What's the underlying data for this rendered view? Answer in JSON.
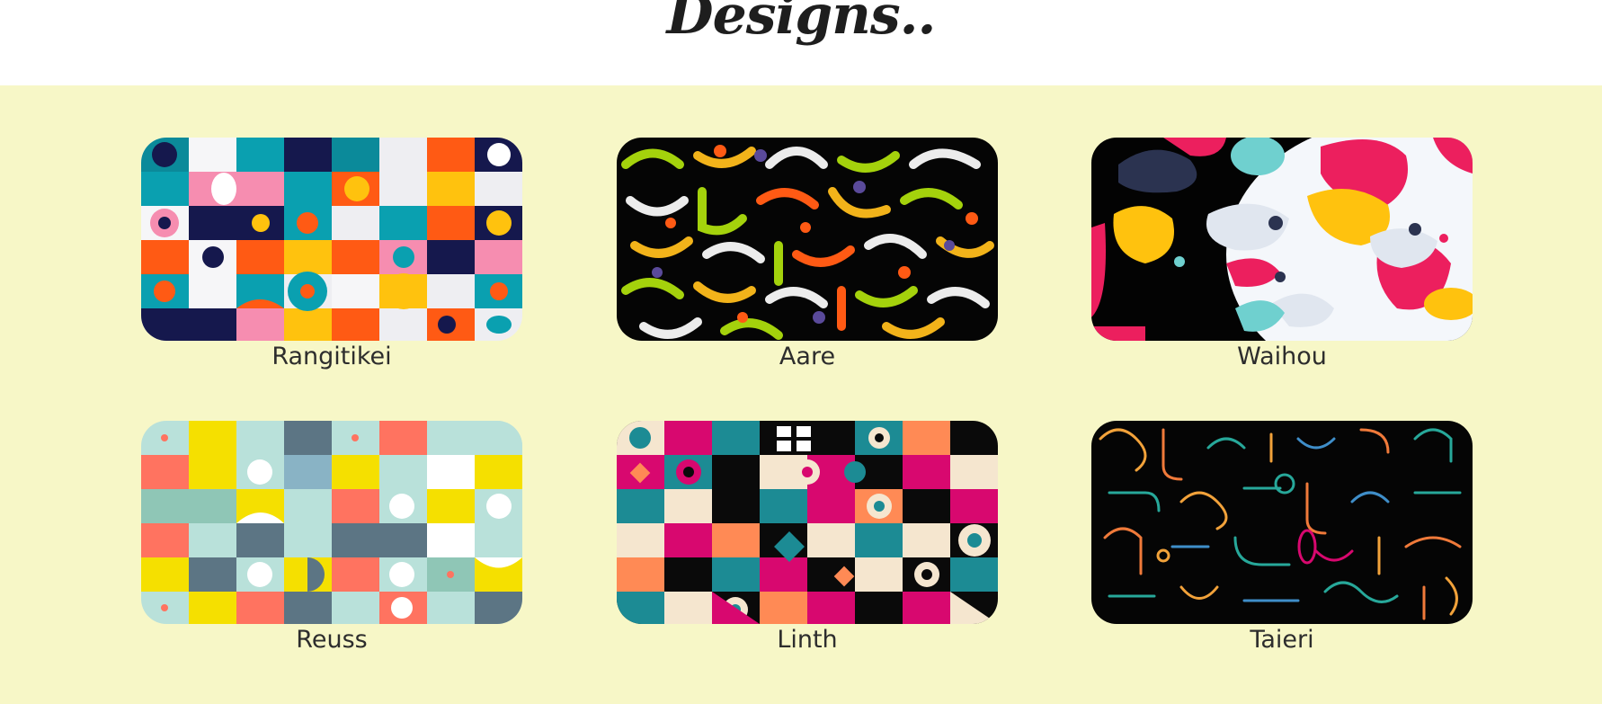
{
  "header": {
    "title": "Designs.."
  },
  "gallery": {
    "items": [
      {
        "label": "Rangitikei"
      },
      {
        "label": "Aare"
      },
      {
        "label": "Waihou"
      },
      {
        "label": "Reuss"
      },
      {
        "label": "Linth"
      },
      {
        "label": "Taieri"
      }
    ]
  },
  "colors": {
    "gallery_background": "#f7f7c7",
    "label_text": "#2d2d2d",
    "title_text": "#1e1e1e"
  }
}
